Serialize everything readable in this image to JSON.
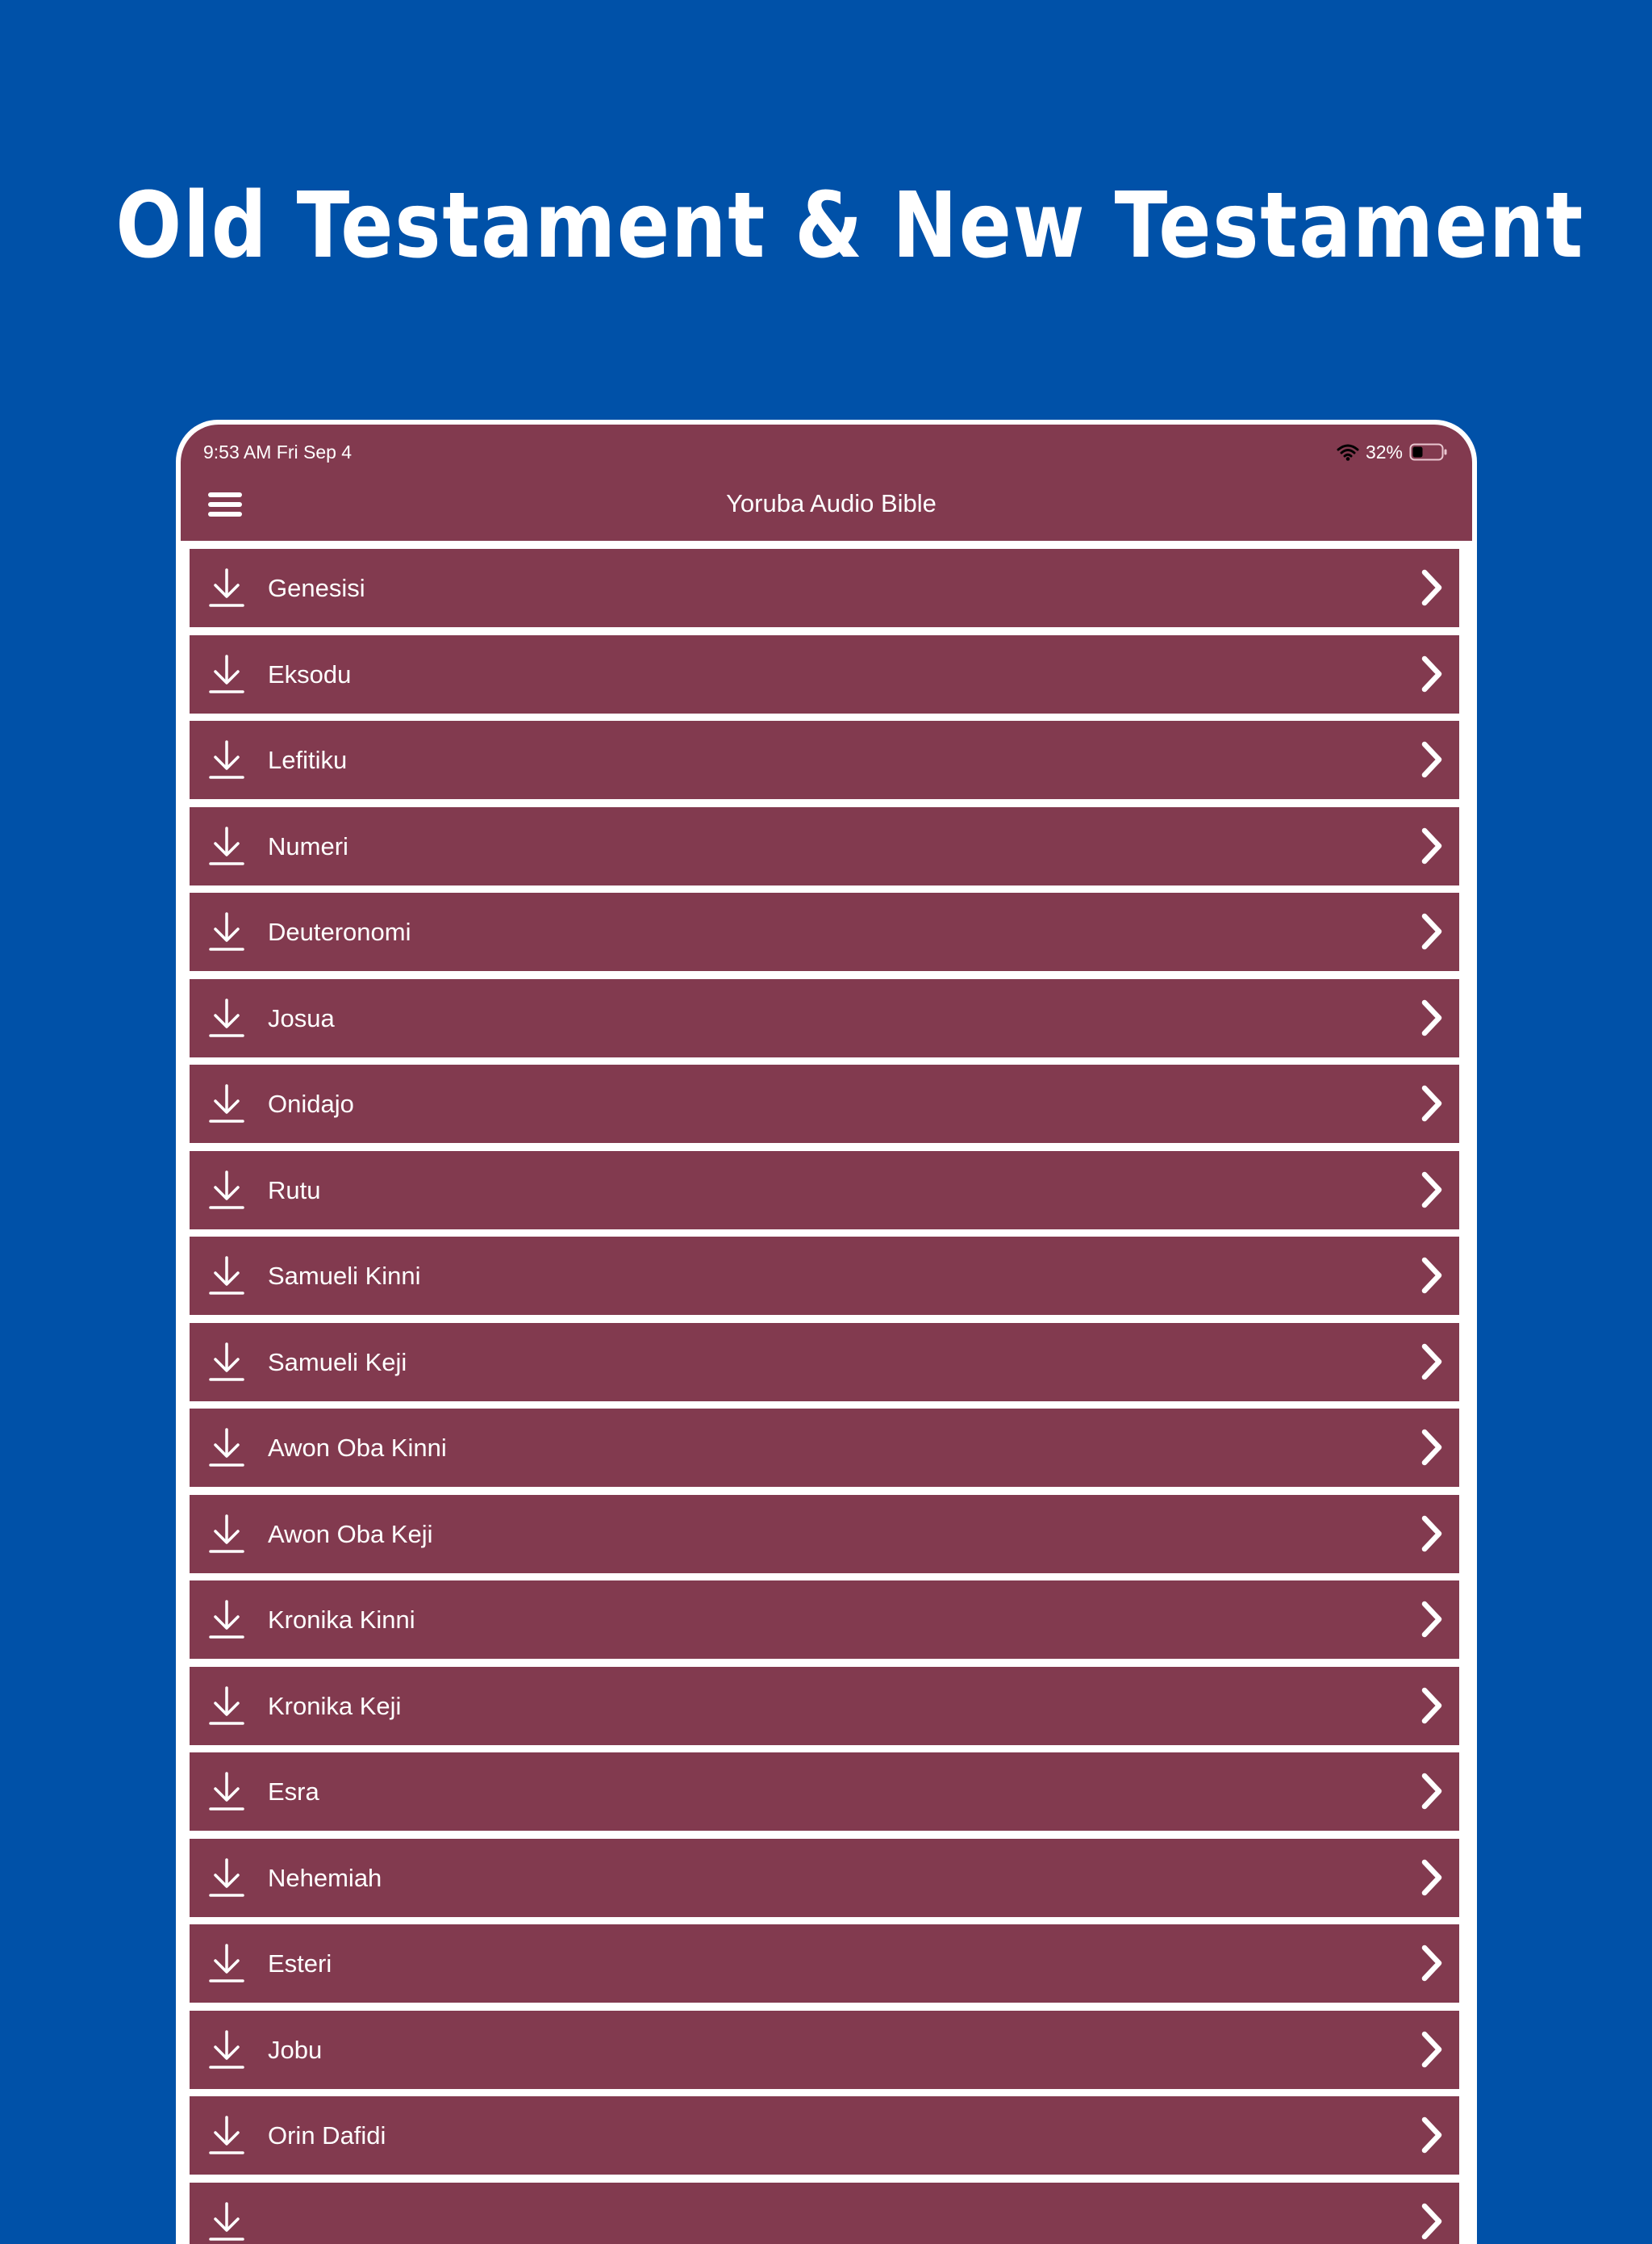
{
  "headline": "Old Testament & New Testament",
  "status_bar": {
    "time": "9:53 AM   Fri Sep 4",
    "battery": "32%"
  },
  "nav": {
    "title": "Yoruba Audio Bible",
    "menu_icon": "hamburger-icon"
  },
  "books": [
    {
      "label": "Genesisi"
    },
    {
      "label": "Eksodu"
    },
    {
      "label": "Lefitiku"
    },
    {
      "label": "Numeri"
    },
    {
      "label": "Deuteronomi"
    },
    {
      "label": "Josua"
    },
    {
      "label": "Onidajo"
    },
    {
      "label": "Rutu"
    },
    {
      "label": "Samueli Kinni"
    },
    {
      "label": "Samueli Keji"
    },
    {
      "label": "Awon Oba Kinni"
    },
    {
      "label": "Awon Oba Keji"
    },
    {
      "label": "Kronika Kinni"
    },
    {
      "label": "Kronika Keji"
    },
    {
      "label": "Esra"
    },
    {
      "label": "Nehemiah"
    },
    {
      "label": "Esteri"
    },
    {
      "label": "Jobu"
    },
    {
      "label": "Orin Dafidi"
    },
    {
      "label": ""
    }
  ],
  "colors": {
    "background": "#0051a8",
    "app_primary": "#823a4f",
    "text": "#ffffff"
  },
  "icons": {
    "row_leading": "download-icon",
    "row_trailing": "chevron-right-icon",
    "status_wifi": "wifi-icon",
    "status_battery": "battery-icon"
  }
}
